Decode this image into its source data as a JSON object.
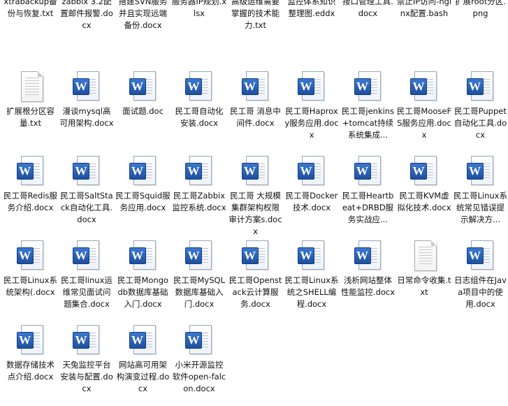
{
  "files": [
    {
      "name": "xtrabackup备份与恢复.txt",
      "type": "txt"
    },
    {
      "name": "zabbix 3.2配置邮件报警.docx",
      "type": "word"
    },
    {
      "name": "搭建SVN服务并且实现远端备份.docx",
      "type": "word"
    },
    {
      "name": "服务器IP规划.xlsx",
      "type": "excel"
    },
    {
      "name": "高级运维需要掌握的技术能力.txt",
      "type": "txt"
    },
    {
      "name": "监控体系知识整理图.eddx",
      "type": "eddx"
    },
    {
      "name": "接口管理工具.docx",
      "type": "word"
    },
    {
      "name": "禁止IP访问-nginx配置.bash",
      "type": "bash"
    },
    {
      "name": "扩展root分区.png",
      "type": "png"
    },
    {
      "name": "扩展根分区容量.txt",
      "type": "txt"
    },
    {
      "name": "漫谈mysql高可用架构.docx",
      "type": "word"
    },
    {
      "name": "面试题.doc",
      "type": "word"
    },
    {
      "name": "民工哥自动化安装.docx",
      "type": "word"
    },
    {
      "name": "民工哥 消息中间件.docx",
      "type": "word"
    },
    {
      "name": "民工哥Haproxy服务应用.docx",
      "type": "word"
    },
    {
      "name": "民工哥jenkins+tomcat持续系统集成...",
      "type": "word"
    },
    {
      "name": "民工哥MooseFS服务应用.docx",
      "type": "word"
    },
    {
      "name": "民工哥Puppet自动化工具.docx",
      "type": "word"
    },
    {
      "name": "民工哥Redis服务介绍.docx",
      "type": "word"
    },
    {
      "name": "民工哥SaltStack自动化工具.docx",
      "type": "word"
    },
    {
      "name": "民工哥Squid服务应用.docx",
      "type": "word"
    },
    {
      "name": "民工哥Zabbix监控系统.docx",
      "type": "word"
    },
    {
      "name": "民工哥 大规模集群架构权限审计方案s.docx",
      "type": "word"
    },
    {
      "name": "民工哥Docker技术.docx",
      "type": "word"
    },
    {
      "name": "民工哥Heartbeat+DRBD服务实战应...",
      "type": "word"
    },
    {
      "name": "民工哥KVM虚拟化技术.docx",
      "type": "word"
    },
    {
      "name": "民工哥Linux系统常见错误提示解决方...",
      "type": "word"
    },
    {
      "name": "民工哥Linux系统架构(.docx",
      "type": "word"
    },
    {
      "name": "民工哥linux运维常见面试问题集合.docx",
      "type": "word"
    },
    {
      "name": "民工哥Mongodb数据库基础入门.docx",
      "type": "word"
    },
    {
      "name": "民工哥MySQL数据库基础入门.docx",
      "type": "word"
    },
    {
      "name": "民工哥Openstack云计算服务.docx",
      "type": "word"
    },
    {
      "name": "民工哥Linux系统之SHELL编程.docx",
      "type": "word"
    },
    {
      "name": "浅析网站整体性能监控.docx",
      "type": "word"
    },
    {
      "name": "日常命令收集.txt",
      "type": "txt"
    },
    {
      "name": "日志组件在Java项目中的使用.docx",
      "type": "word"
    },
    {
      "name": "数据存储技术点介绍.docx",
      "type": "word"
    },
    {
      "name": "天兔监控平台安装与配置.docx",
      "type": "word"
    },
    {
      "name": "网站高可用架构演变过程.docx",
      "type": "word"
    },
    {
      "name": "小米开源监控软件open-falcon.docx",
      "type": "word"
    }
  ],
  "icon_names": {
    "word": "word-document-icon",
    "txt": "text-file-icon"
  },
  "colors": {
    "word_badge": "#2b63b8",
    "selection": "#cce8ff"
  }
}
